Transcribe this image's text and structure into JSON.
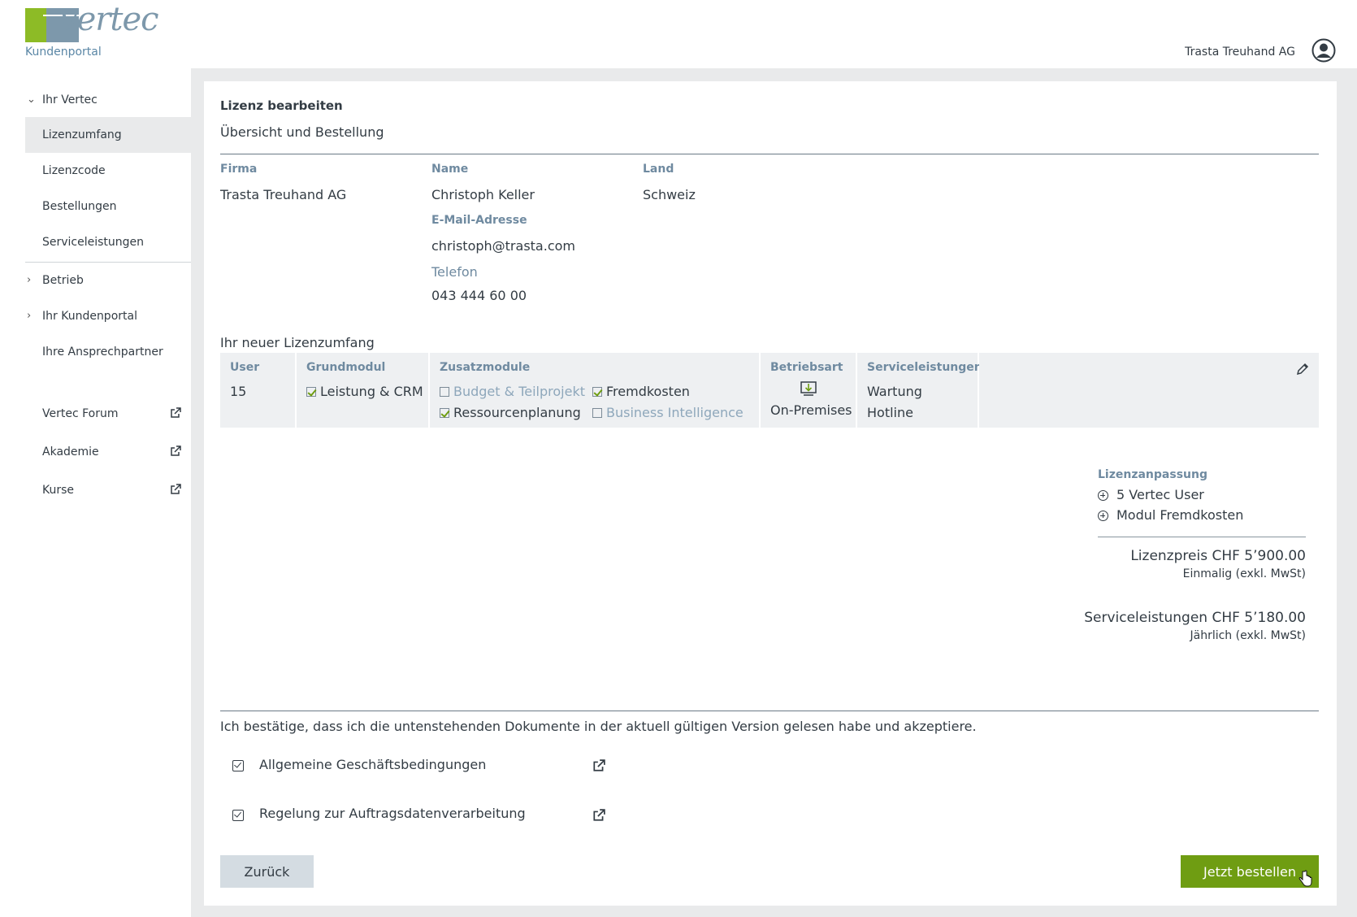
{
  "header": {
    "logo_text": "vertec",
    "portal_label": "Kundenportal",
    "company_name": "Trasta Treuhand AG"
  },
  "sidebar": {
    "groups": [
      {
        "label": "Ihr Vertec",
        "expanded": true
      },
      {
        "label": "Betrieb",
        "expanded": false
      },
      {
        "label": "Ihr Kundenportal",
        "expanded": false
      }
    ],
    "items": [
      {
        "label": "Lizenzumfang",
        "active": true
      },
      {
        "label": "Lizenzcode"
      },
      {
        "label": "Bestellungen"
      },
      {
        "label": "Serviceleistungen"
      }
    ],
    "contacts_label": "Ihre Ansprechpartner",
    "external_links": [
      {
        "label": "Vertec Forum"
      },
      {
        "label": "Akademie"
      },
      {
        "label": "Kurse"
      }
    ]
  },
  "main": {
    "title": "Lizenz bearbeiten",
    "subtitle": "Übersicht und Bestellung",
    "customer": {
      "firma_label": "Firma",
      "firma": "Trasta Treuhand AG",
      "name_label": "Name",
      "name": "Christoph Keller",
      "email_label": "E-Mail-Adresse",
      "email": "christoph@trasta.com",
      "phone_label": "Telefon",
      "phone": "043 444 60 00",
      "land_label": "Land",
      "land": "Schweiz"
    },
    "license": {
      "section_title": "Ihr neuer Lizenzumfang",
      "user_label": "User",
      "user_count": "15",
      "grundmodul_label": "Grundmodul",
      "grundmodul": "Leistung & CRM",
      "zusatz_label": "Zusatzmodule",
      "modules": [
        {
          "label": "Budget & Teilprojekt",
          "checked": false
        },
        {
          "label": "Fremdkosten",
          "checked": true
        },
        {
          "label": "Ressourcenplanung",
          "checked": true
        },
        {
          "label": "Business Intelligence",
          "checked": false
        }
      ],
      "betriebsart_label": "Betriebsart",
      "betriebsart": "On-Premises",
      "service_label": "Serviceleistungen",
      "services": [
        "Wartung",
        "Hotline"
      ]
    },
    "adjustment": {
      "title": "Lizenzanpassung",
      "items": [
        "5 Vertec User",
        "Modul Fremdkosten"
      ]
    },
    "license_price": {
      "label": "Lizenzpreis CHF 5’900.00",
      "note": "Einmalig (exkl. MwSt)"
    },
    "service_price": {
      "label": "Serviceleistungen CHF 5’180.00",
      "note": "Jährlich (exkl. MwSt)"
    },
    "confirm_text": "Ich bestätige, dass ich die untenstehenden Dokumente in der aktuell gültigen Version gelesen habe und akzeptiere.",
    "documents": [
      {
        "label": "Allgemeine Geschäftsbedingungen",
        "checked": true
      },
      {
        "label": "Regelung zur Auftragsdatenverarbeitung",
        "checked": true
      }
    ],
    "back_button": "Zurück",
    "order_button": "Jetzt bestellen"
  },
  "colors": {
    "accent_green": "#6f9d12",
    "logo_green": "#8dbb26",
    "logo_blue": "#7d98ab",
    "label_blue": "#6f8aa0",
    "frame_grey": "#e9eaeb"
  }
}
